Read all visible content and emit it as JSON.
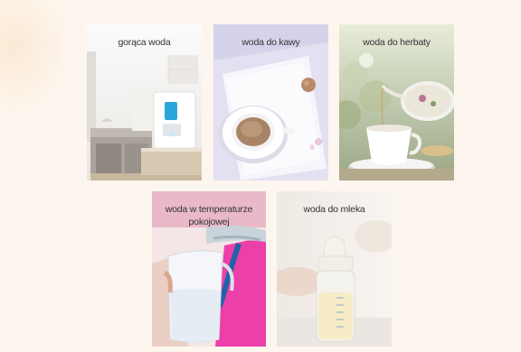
{
  "cards": [
    {
      "label": "gorąca woda"
    },
    {
      "label": "woda do kawy"
    },
    {
      "label": "woda do herbaty"
    },
    {
      "label": "woda w temperaturze pokojowej"
    },
    {
      "label": "woda do mleka"
    }
  ]
}
